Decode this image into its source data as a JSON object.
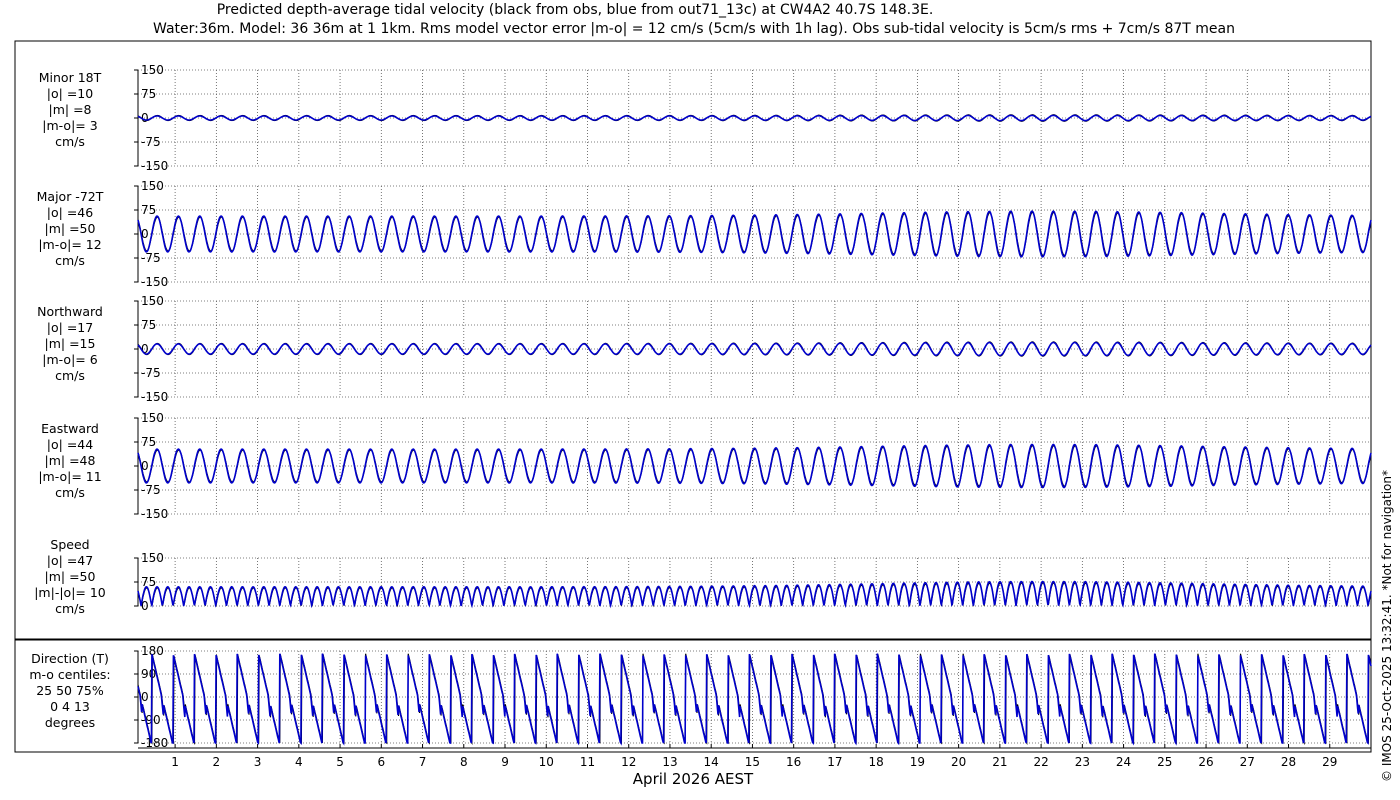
{
  "header": {
    "title_line1": "Predicted depth-average tidal velocity (black from obs, blue from out71_13c) at CW4A2 40.7S 148.3E.",
    "title_line2": "Water:36m. Model: 36 36m at 1 1km. Rms model vector error |m-o| = 12 cm/s (5cm/s with 1h lag). Obs sub-tidal velocity is 5cm/s rms + 7cm/s 87T mean"
  },
  "side_note": "© IMOS 25-Oct-2025 13:32:41. *Not for navigation*",
  "colors": {
    "obs": "#000000",
    "model": "#0000cc",
    "grid": "#555555"
  },
  "chart_data": {
    "type": "line",
    "xlabel": "April 2026 AEST",
    "x_ticks": [
      "1",
      "2",
      "3",
      "4",
      "5",
      "6",
      "7",
      "8",
      "9",
      "10",
      "11",
      "12",
      "13",
      "14",
      "15",
      "16",
      "17",
      "18",
      "19",
      "20",
      "21",
      "22",
      "23",
      "24",
      "25",
      "26",
      "27",
      "28",
      "29"
    ],
    "xlim": [
      0.1,
      30.0
    ],
    "series_names": [
      "obs",
      "model"
    ],
    "panels": [
      {
        "id": "minor",
        "label_lines": [
          "Minor 18T",
          "|o| =10",
          "|m| =8",
          "|m-o|= 3",
          "cm/s"
        ],
        "ylim": [
          -150,
          150
        ],
        "yticks": [
          "150",
          "75",
          "0",
          "-75",
          "-150"
        ],
        "amplitude_obs": 10,
        "amplitude_model": 8
      },
      {
        "id": "major",
        "label_lines": [
          "Major -72T",
          "|o| =46",
          "|m| =50",
          "|m-o|= 12",
          "cm/s"
        ],
        "ylim": [
          -150,
          150
        ],
        "yticks": [
          "150",
          "75",
          "0",
          "-75",
          "-150"
        ],
        "amplitude_obs": 66,
        "amplitude_model": 70
      },
      {
        "id": "northward",
        "label_lines": [
          "Northward",
          "|o| =17",
          "|m| =15",
          "|m-o|= 6",
          "cm/s"
        ],
        "ylim": [
          -150,
          150
        ],
        "yticks": [
          "150",
          "75",
          "0",
          "-75",
          "-150"
        ],
        "amplitude_obs": 22,
        "amplitude_model": 20
      },
      {
        "id": "eastward",
        "label_lines": [
          "Eastward",
          "|o| =44",
          "|m| =48",
          "|m-o|= 11",
          "cm/s"
        ],
        "ylim": [
          -150,
          150
        ],
        "yticks": [
          "150",
          "75",
          "0",
          "-75",
          "-150"
        ],
        "amplitude_obs": 62,
        "amplitude_model": 66
      },
      {
        "id": "speed",
        "label_lines": [
          "Speed",
          "|o| =47",
          "|m| =50",
          "|m|-|o|= 10",
          "cm/s"
        ],
        "ylim": [
          0,
          150
        ],
        "yticks": [
          "150",
          "75",
          "0"
        ],
        "amplitude_obs": 47,
        "amplitude_model": 50
      },
      {
        "id": "direction",
        "label_lines": [
          "Direction (T)",
          "m-o centiles:",
          "25  50  75%",
          "0   4  13",
          "degrees"
        ],
        "ylim": [
          -180,
          180
        ],
        "yticks": [
          "180",
          "90",
          "0",
          "-90",
          "-180"
        ]
      }
    ]
  }
}
